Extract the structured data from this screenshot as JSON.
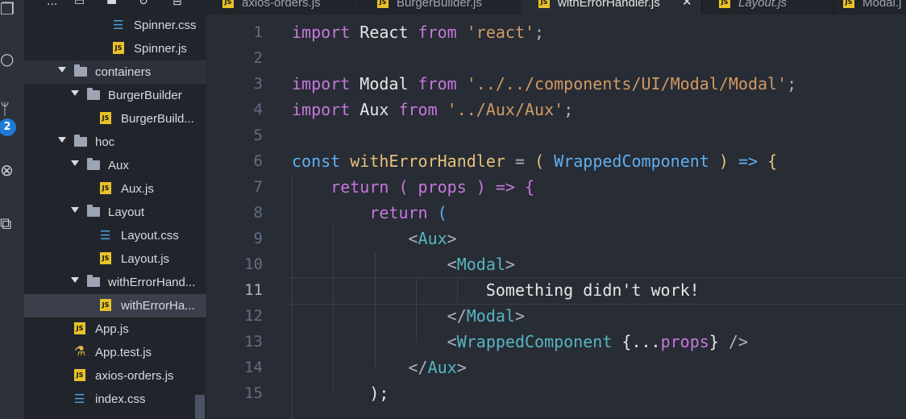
{
  "activity_bar": {
    "scm_badge": "2",
    "icons": [
      "files-icon",
      "search-icon",
      "source-control-icon",
      "debug-icon",
      "extensions-icon"
    ]
  },
  "explorer": {
    "toolbar_icons": [
      "more-icon",
      "new-file-icon",
      "new-folder-icon",
      "refresh-icon",
      "collapse-icon"
    ],
    "more_label": "...",
    "items": [
      {
        "label": "Spinner.css",
        "kind": "css"
      },
      {
        "label": "Spinner.js",
        "kind": "js"
      },
      {
        "label": "containers",
        "kind": "folder"
      },
      {
        "label": "BurgerBuilder",
        "kind": "folder"
      },
      {
        "label": "BurgerBuild...",
        "kind": "js"
      },
      {
        "label": "hoc",
        "kind": "folder"
      },
      {
        "label": "Aux",
        "kind": "folder"
      },
      {
        "label": "Aux.js",
        "kind": "js"
      },
      {
        "label": "Layout",
        "kind": "folder"
      },
      {
        "label": "Layout.css",
        "kind": "css"
      },
      {
        "label": "Layout.js",
        "kind": "js"
      },
      {
        "label": "withErrorHand...",
        "kind": "folder"
      },
      {
        "label": "withErrorHa...",
        "kind": "js"
      },
      {
        "label": "App.js",
        "kind": "js"
      },
      {
        "label": "App.test.js",
        "kind": "test"
      },
      {
        "label": "axios-orders.js",
        "kind": "js"
      },
      {
        "label": "index.css",
        "kind": "css"
      }
    ]
  },
  "tabs": [
    {
      "label": "axios-orders.js",
      "active": false
    },
    {
      "label": "BurgerBuilder.js",
      "active": false
    },
    {
      "label": "withErrorHandler.js",
      "active": true
    },
    {
      "label": "Layout.js",
      "active": false,
      "italic": true
    },
    {
      "label": "Modal.j",
      "active": false
    }
  ],
  "js_badge": "JS",
  "close_glyph": "✕",
  "editor": {
    "file": "withErrorHandler.js",
    "current_line": 11,
    "lines": [
      {
        "n": "1",
        "tokens": [
          {
            "t": "import",
            "c": "kw"
          },
          {
            "t": " React ",
            "c": "df"
          },
          {
            "t": "from",
            "c": "kw"
          },
          {
            "t": " 'react'",
            "c": "str"
          },
          {
            "t": ";",
            "c": "punc"
          }
        ]
      },
      {
        "n": "2",
        "tokens": []
      },
      {
        "n": "3",
        "tokens": [
          {
            "t": "import",
            "c": "kw"
          },
          {
            "t": " Modal ",
            "c": "df"
          },
          {
            "t": "from",
            "c": "kw"
          },
          {
            "t": " '../../components/UI/Modal/Modal'",
            "c": "str"
          },
          {
            "t": ";",
            "c": "punc"
          }
        ]
      },
      {
        "n": "4",
        "tokens": [
          {
            "t": "import",
            "c": "kw"
          },
          {
            "t": " Aux ",
            "c": "df"
          },
          {
            "t": "from",
            "c": "kw"
          },
          {
            "t": " '../Aux/Aux'",
            "c": "str"
          },
          {
            "t": ";",
            "c": "punc"
          }
        ]
      },
      {
        "n": "5",
        "tokens": []
      },
      {
        "n": "6",
        "tokens": [
          {
            "t": "const",
            "c": "cls"
          },
          {
            "t": " withErrorHandler ",
            "c": "fn"
          },
          {
            "t": "= ",
            "c": "punc"
          },
          {
            "t": "( ",
            "c": "brk"
          },
          {
            "t": "WrappedComponent",
            "c": "cls"
          },
          {
            "t": " ) ",
            "c": "brk"
          },
          {
            "t": "=>",
            "c": "cls"
          },
          {
            "t": " {",
            "c": "brk"
          }
        ]
      },
      {
        "n": "7",
        "tokens": [
          {
            "t": "    ",
            "c": "df"
          },
          {
            "t": "return",
            "c": "kw"
          },
          {
            "t": " ( ",
            "c": "kw"
          },
          {
            "t": "props",
            "c": "kw"
          },
          {
            "t": " ) ",
            "c": "kw"
          },
          {
            "t": "=>",
            "c": "kw"
          },
          {
            "t": " {",
            "c": "kw"
          }
        ]
      },
      {
        "n": "8",
        "tokens": [
          {
            "t": "        ",
            "c": "df"
          },
          {
            "t": "return",
            "c": "kw"
          },
          {
            "t": " (",
            "c": "cls"
          }
        ]
      },
      {
        "n": "9",
        "tokens": [
          {
            "t": "            ",
            "c": "df"
          },
          {
            "t": "<",
            "c": "punc"
          },
          {
            "t": "Aux",
            "c": "tag"
          },
          {
            "t": ">",
            "c": "punc"
          }
        ]
      },
      {
        "n": "10",
        "tokens": [
          {
            "t": "                ",
            "c": "df"
          },
          {
            "t": "<",
            "c": "punc"
          },
          {
            "t": "Modal",
            "c": "tag"
          },
          {
            "t": ">",
            "c": "punc"
          }
        ]
      },
      {
        "n": "11",
        "tokens": [
          {
            "t": "                    Something didn't work!",
            "c": "df"
          }
        ]
      },
      {
        "n": "12",
        "tokens": [
          {
            "t": "                ",
            "c": "df"
          },
          {
            "t": "</",
            "c": "punc"
          },
          {
            "t": "Modal",
            "c": "tag"
          },
          {
            "t": ">",
            "c": "punc"
          }
        ]
      },
      {
        "n": "13",
        "tokens": [
          {
            "t": "                ",
            "c": "df"
          },
          {
            "t": "<",
            "c": "punc"
          },
          {
            "t": "WrappedComponent",
            "c": "tag"
          },
          {
            "t": " {",
            "c": "df"
          },
          {
            "t": "...",
            "c": "df"
          },
          {
            "t": "props",
            "c": "kw"
          },
          {
            "t": "} ",
            "c": "df"
          },
          {
            "t": "/>",
            "c": "punc"
          }
        ]
      },
      {
        "n": "14",
        "tokens": [
          {
            "t": "            ",
            "c": "df"
          },
          {
            "t": "</",
            "c": "punc"
          },
          {
            "t": "Aux",
            "c": "tag"
          },
          {
            "t": ">",
            "c": "punc"
          }
        ]
      },
      {
        "n": "15",
        "tokens": [
          {
            "t": "        ",
            "c": "df"
          },
          {
            "t": ");",
            "c": "df"
          }
        ]
      }
    ]
  }
}
